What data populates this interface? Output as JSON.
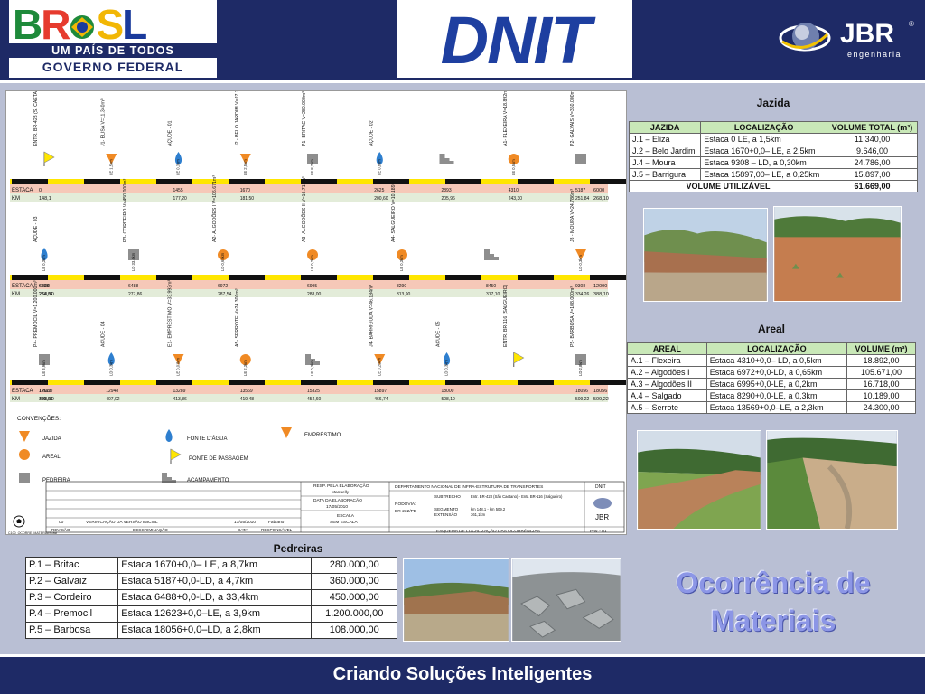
{
  "header": {
    "brasil_letters": [
      "B",
      "R",
      "A",
      "S",
      "L"
    ],
    "brasil_tagline": "UM PAÍS DE TODOS",
    "brasil_gov": "GOVERNO FEDERAL",
    "dnit": "DNIT",
    "jbr": "JBR",
    "jbr_reg": "®",
    "jbr_sub": "engenharia"
  },
  "drawing": {
    "rows": [
      {
        "estaca_label": "ESTACA",
        "km_label": "KM",
        "estaca_start": "0",
        "km_start": "148,1",
        "estaca_end": "6000",
        "km_end": "268,10",
        "items": [
          {
            "kind": "jazida",
            "name": "ENTR. BR-423 (S. CAETANO)",
            "est": "",
            "km": ""
          },
          {
            "kind": "emprestimo",
            "name": "J1- ELISA V=11.340m³",
            "est": "",
            "km": "",
            "side": "LE",
            "dist": "1,5km"
          },
          {
            "kind": "agua",
            "name": "AÇUDE - 01",
            "est": "1455",
            "km": "177,20",
            "side": "LE",
            "dist": "0,3km"
          },
          {
            "kind": "emprestimo",
            "name": "J2 - BELO JARDIM V=27.313m³",
            "est": "1670",
            "km": "181,50",
            "side": "LE",
            "dist": "2,5km"
          },
          {
            "kind": "pedreira",
            "name": "P1- BRITAC V=280.000m³",
            "est": "",
            "km": "",
            "side": "LE",
            "dist": "8,7km"
          },
          {
            "kind": "agua",
            "name": "AÇUDE - 02",
            "est": "2625",
            "km": "200,60",
            "side": "LE",
            "dist": "0,8km"
          },
          {
            "kind": "acampamento",
            "name": "",
            "est": "2893",
            "km": "205,96"
          },
          {
            "kind": "areal",
            "name": "A1- FLEXEIRA V=18.892m³",
            "est": "4310",
            "km": "243,30",
            "side": "LE",
            "dist": "0,5km"
          },
          {
            "kind": "pedreira",
            "name": "P2- GALVAIS V=360.000m³",
            "est": "5187",
            "km": "251,84"
          }
        ]
      },
      {
        "estaca_label": "ESTACA",
        "km_label": "KM",
        "estaca_start": "6000",
        "km_start": "268,10",
        "estaca_end": "12000",
        "km_end": "388,10",
        "items": [
          {
            "kind": "agua",
            "name": "AÇUDE - 03",
            "est": "6338",
            "km": "274,86",
            "side": "LE",
            "dist": "0,3km"
          },
          {
            "kind": "pedreira",
            "name": "P3- CORDEIRO V=450.000m³",
            "est": "6488",
            "km": "277,86",
            "side": "LD",
            "dist": "33,4km"
          },
          {
            "kind": "areal",
            "name": "A2- ALGODÕES I V=105.671m³",
            "est": "6972",
            "km": "287,54",
            "side": "LD",
            "dist": "0,65km"
          },
          {
            "kind": "areal",
            "name": "A3- ALGODÕES II V=16.718m³",
            "est": "6995",
            "km": "288,00",
            "side": "LE",
            "dist": "0,2km"
          },
          {
            "kind": "areal",
            "name": "A4- SALGUEIRO V=10.189m³",
            "est": "8290",
            "km": "313,90",
            "side": "LE",
            "dist": "0,3km"
          },
          {
            "kind": "acampamento",
            "name": "",
            "est": "8450",
            "km": "317,10"
          },
          {
            "kind": "emprestimo",
            "name": "J3 - MOURA V=24.786m³",
            "est": "9308",
            "km": "334,26",
            "side": "LD",
            "dist": "0,3km"
          }
        ]
      },
      {
        "estaca_label": "ESTACA",
        "km_label": "KM",
        "estaca_start": "12000",
        "km_start": "388,10",
        "estaca_end": "18056",
        "km_end": "509,22",
        "items": [
          {
            "kind": "pedreira",
            "name": "P4- PREMOCIL V=1.200.000m³",
            "est": "12623",
            "km": "400,56",
            "side": "LE",
            "dist": "3,9km"
          },
          {
            "kind": "agua",
            "name": "AÇUDE - 04",
            "est": "12948",
            "km": "407,02",
            "side": "LD",
            "dist": "0,3km"
          },
          {
            "kind": "emprestimo",
            "name": "E1- EMPRÉSTIMO V=33.993m³",
            "est": "13289",
            "km": "413,86",
            "side": "LE",
            "dist": "0,01km"
          },
          {
            "kind": "areal",
            "name": "A5- SERROTE V=24.300m³",
            "est": "13569",
            "km": "419,48",
            "side": "LE",
            "dist": "2,3km"
          },
          {
            "kind": "acampamento",
            "name": "",
            "est": "15325",
            "km": "454,60",
            "side": "LE",
            "dist": "0,3km"
          },
          {
            "kind": "emprestimo",
            "name": "J4- BARRIGUDA V=46.184m³",
            "est": "15897",
            "km": "466,74",
            "side": "LE",
            "dist": "0,25km"
          },
          {
            "kind": "agua",
            "name": "AÇUDE - 05",
            "est": "18000",
            "km": "508,10",
            "side": "LD",
            "dist": "0,3km"
          },
          {
            "kind": "jazida",
            "name": "ENTR. BR-116 (SALGUEIRO)",
            "est": "",
            "": ""
          },
          {
            "kind": "pedreira",
            "name": "P5- BARBOSA V=108.000m³",
            "est": "18056",
            "km": "509,22",
            "side": "LD",
            "dist": "2,8km"
          }
        ]
      }
    ],
    "legend_title": "CONVENÇÕES:",
    "legend": {
      "jazida": "JAZIDA",
      "agua": "FONTE D'ÁGUA",
      "emprestimo": "EMPRÉSTIMO",
      "areal": "AREAL",
      "passagem": "PONTE DE PASSAGEM",
      "pedreira": "PEDREIRA",
      "acampamento": "ACAMPAMENTO"
    },
    "titleblock": {
      "resp_label": "RESP. PELA ELABORAÇÃO",
      "resp_value": "Manuelly",
      "date_label": "DATA DA ELABORAÇÃO",
      "date_value": "17/05/2010",
      "escala_label": "ESCALA",
      "escala_value": "SEM ESCALA",
      "dept": "DEPARTAMENTO NACIONAL DE INFRA-ESTRUTURA DE TRANSPORTES",
      "dnit": "DNIT",
      "rodovia_label": "RODOVIA:",
      "rodovia_value": "BR-232/PE",
      "subtrecho_label": "SUBTRECHO",
      "subtrecho_value": "Entr. BR-423 (São Caetano) - Entr. BR-116 (Salgueiro)",
      "segmento_label": "SEGMENTO",
      "segmento_value": "km 148,1 - km 509,2",
      "extensao_label": "EXTENSÃO",
      "extensao_value": "361,1km",
      "rev_num": "00",
      "rev_desc": "VERIFICAÇÃO DA VERSÃO INICIAL",
      "rev_date": "17/05/2010",
      "rev_resp": "Fabiano",
      "h_rev": "REVISÃO",
      "h_desc": "DESCRIMINAÇÃO",
      "h_date": "DATA",
      "h_resp": "RESPONSÁVEL",
      "esquema": "ESQUEMA DE LOCALIZAÇÃO DAS OCORRÊNCIAS",
      "pav": "PAV - 01",
      "jbr": "JBR",
      "file": "C100_OCORRE_MATERIAIS.dwt"
    }
  },
  "jazida": {
    "title": "Jazida",
    "headers": [
      "JAZIDA",
      "LOCALIZAÇÃO",
      "VOLUME TOTAL (m³)"
    ],
    "rows": [
      [
        "J.1 – Eliza",
        "Estaca 0 LE, a 1,5km",
        "11.340,00"
      ],
      [
        "J.2 – Belo Jardim",
        "Estaca 1670+0,0– LE, a 2,5km",
        "9.646,00"
      ],
      [
        "J.4 – Moura",
        "Estaca 9308 – LD, a 0,30km",
        "24.786,00"
      ],
      [
        "J.5 – Barrigura",
        "Estaca 15897,00– LE, a 0,25km",
        "15.897,00"
      ]
    ],
    "total_label": "VOLUME UTILIZÁVEL",
    "total_value": "61.669,00"
  },
  "areal": {
    "title": "Areal",
    "headers": [
      "AREAL",
      "LOCALIZAÇÃO",
      "VOLUME (m³)"
    ],
    "rows": [
      [
        "A.1 – Flexeira",
        "Estaca 4310+0,0– LD, a 0,5km",
        "18.892,00"
      ],
      [
        "A.2 – Algodões I",
        "Estaca 6972+0,0-LD, a 0,65km",
        "105.671,00"
      ],
      [
        "A.3 – Algodões II",
        "Estaca 6995+0,0-LE, a 0,2km",
        "16.718,00"
      ],
      [
        "A.4 – Salgado",
        "Estaca 8290+0,0-LE, a 0,3km",
        "10.189,00"
      ],
      [
        "A.5 – Serrote",
        "Estaca 13569+0,0–LE, a 2,3km",
        "24.300,00"
      ]
    ]
  },
  "pedreiras": {
    "title": "Pedreiras",
    "rows": [
      [
        "P.1 – Britac",
        "Estaca 1670+0,0– LE, a 8,7km",
        "280.000,00"
      ],
      [
        "P.2 – Galvaiz",
        "Estaca 5187+0,0-LD, a 4,7km",
        "360.000,00"
      ],
      [
        "P.3 – Cordeiro",
        "Estaca 6488+0,0-LD, a 33,4km",
        "450.000,00"
      ],
      [
        "P.4 – Premocil",
        "Estaca 12623+0,0–LE, a 3,9km",
        "1.200.000,00"
      ],
      [
        "P.5 – Barbosa",
        "Estaca 18056+0,0–LD, a 2,8km",
        "108.000,00"
      ]
    ]
  },
  "slide_title_line1": "Ocorrência de",
  "slide_title_line2": "Materiais",
  "footer": "Criando Soluções Inteligentes",
  "colors": {
    "navy": "#1e2a66",
    "road_yellow": "#ffe600",
    "estaca_pink": "#f6c8b8",
    "km_green": "#e3ecd9",
    "table_head": "#c9e8b8"
  }
}
